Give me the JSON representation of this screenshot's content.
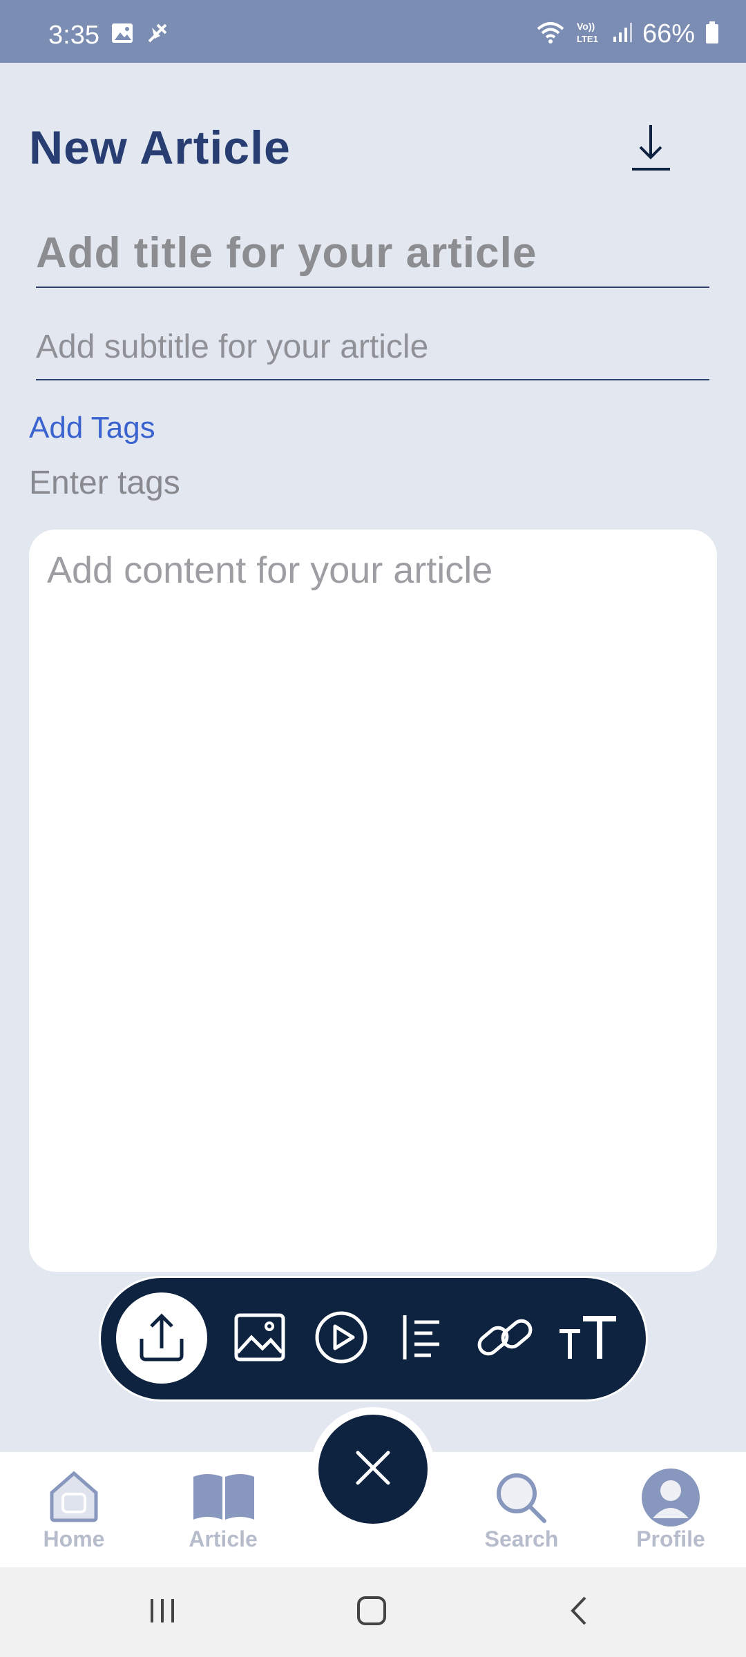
{
  "status_bar": {
    "time": "3:35",
    "battery": "66%",
    "icons": [
      "gallery-icon",
      "muted-icon",
      "wifi-icon",
      "volte-icon",
      "signal-icon",
      "battery-icon"
    ]
  },
  "header": {
    "title": "New Article",
    "download_icon": "download-icon"
  },
  "form": {
    "title_placeholder": "Add title for your article",
    "subtitle_placeholder": "Add subtitle for your article",
    "add_tags_label": "Add Tags",
    "tags_placeholder": "Enter tags",
    "content_placeholder": "Add content for your article"
  },
  "toolbar": {
    "tools": [
      "upload-icon",
      "image-icon",
      "video-icon",
      "list-icon",
      "link-icon",
      "text-size-icon"
    ]
  },
  "bottom_nav": {
    "items": [
      {
        "label": "Home",
        "icon": "home-icon"
      },
      {
        "label": "Article",
        "icon": "book-icon"
      },
      {
        "label": "Search",
        "icon": "search-icon"
      },
      {
        "label": "Profile",
        "icon": "profile-icon"
      }
    ],
    "fab_icon": "close-icon"
  },
  "colors": {
    "status_bar": "#7b8db3",
    "background": "#e3e8f0",
    "title": "#283e73",
    "accent_link": "#3a63cf",
    "toolbar": "#0e2340",
    "nav_inactive": "#8797bd"
  }
}
